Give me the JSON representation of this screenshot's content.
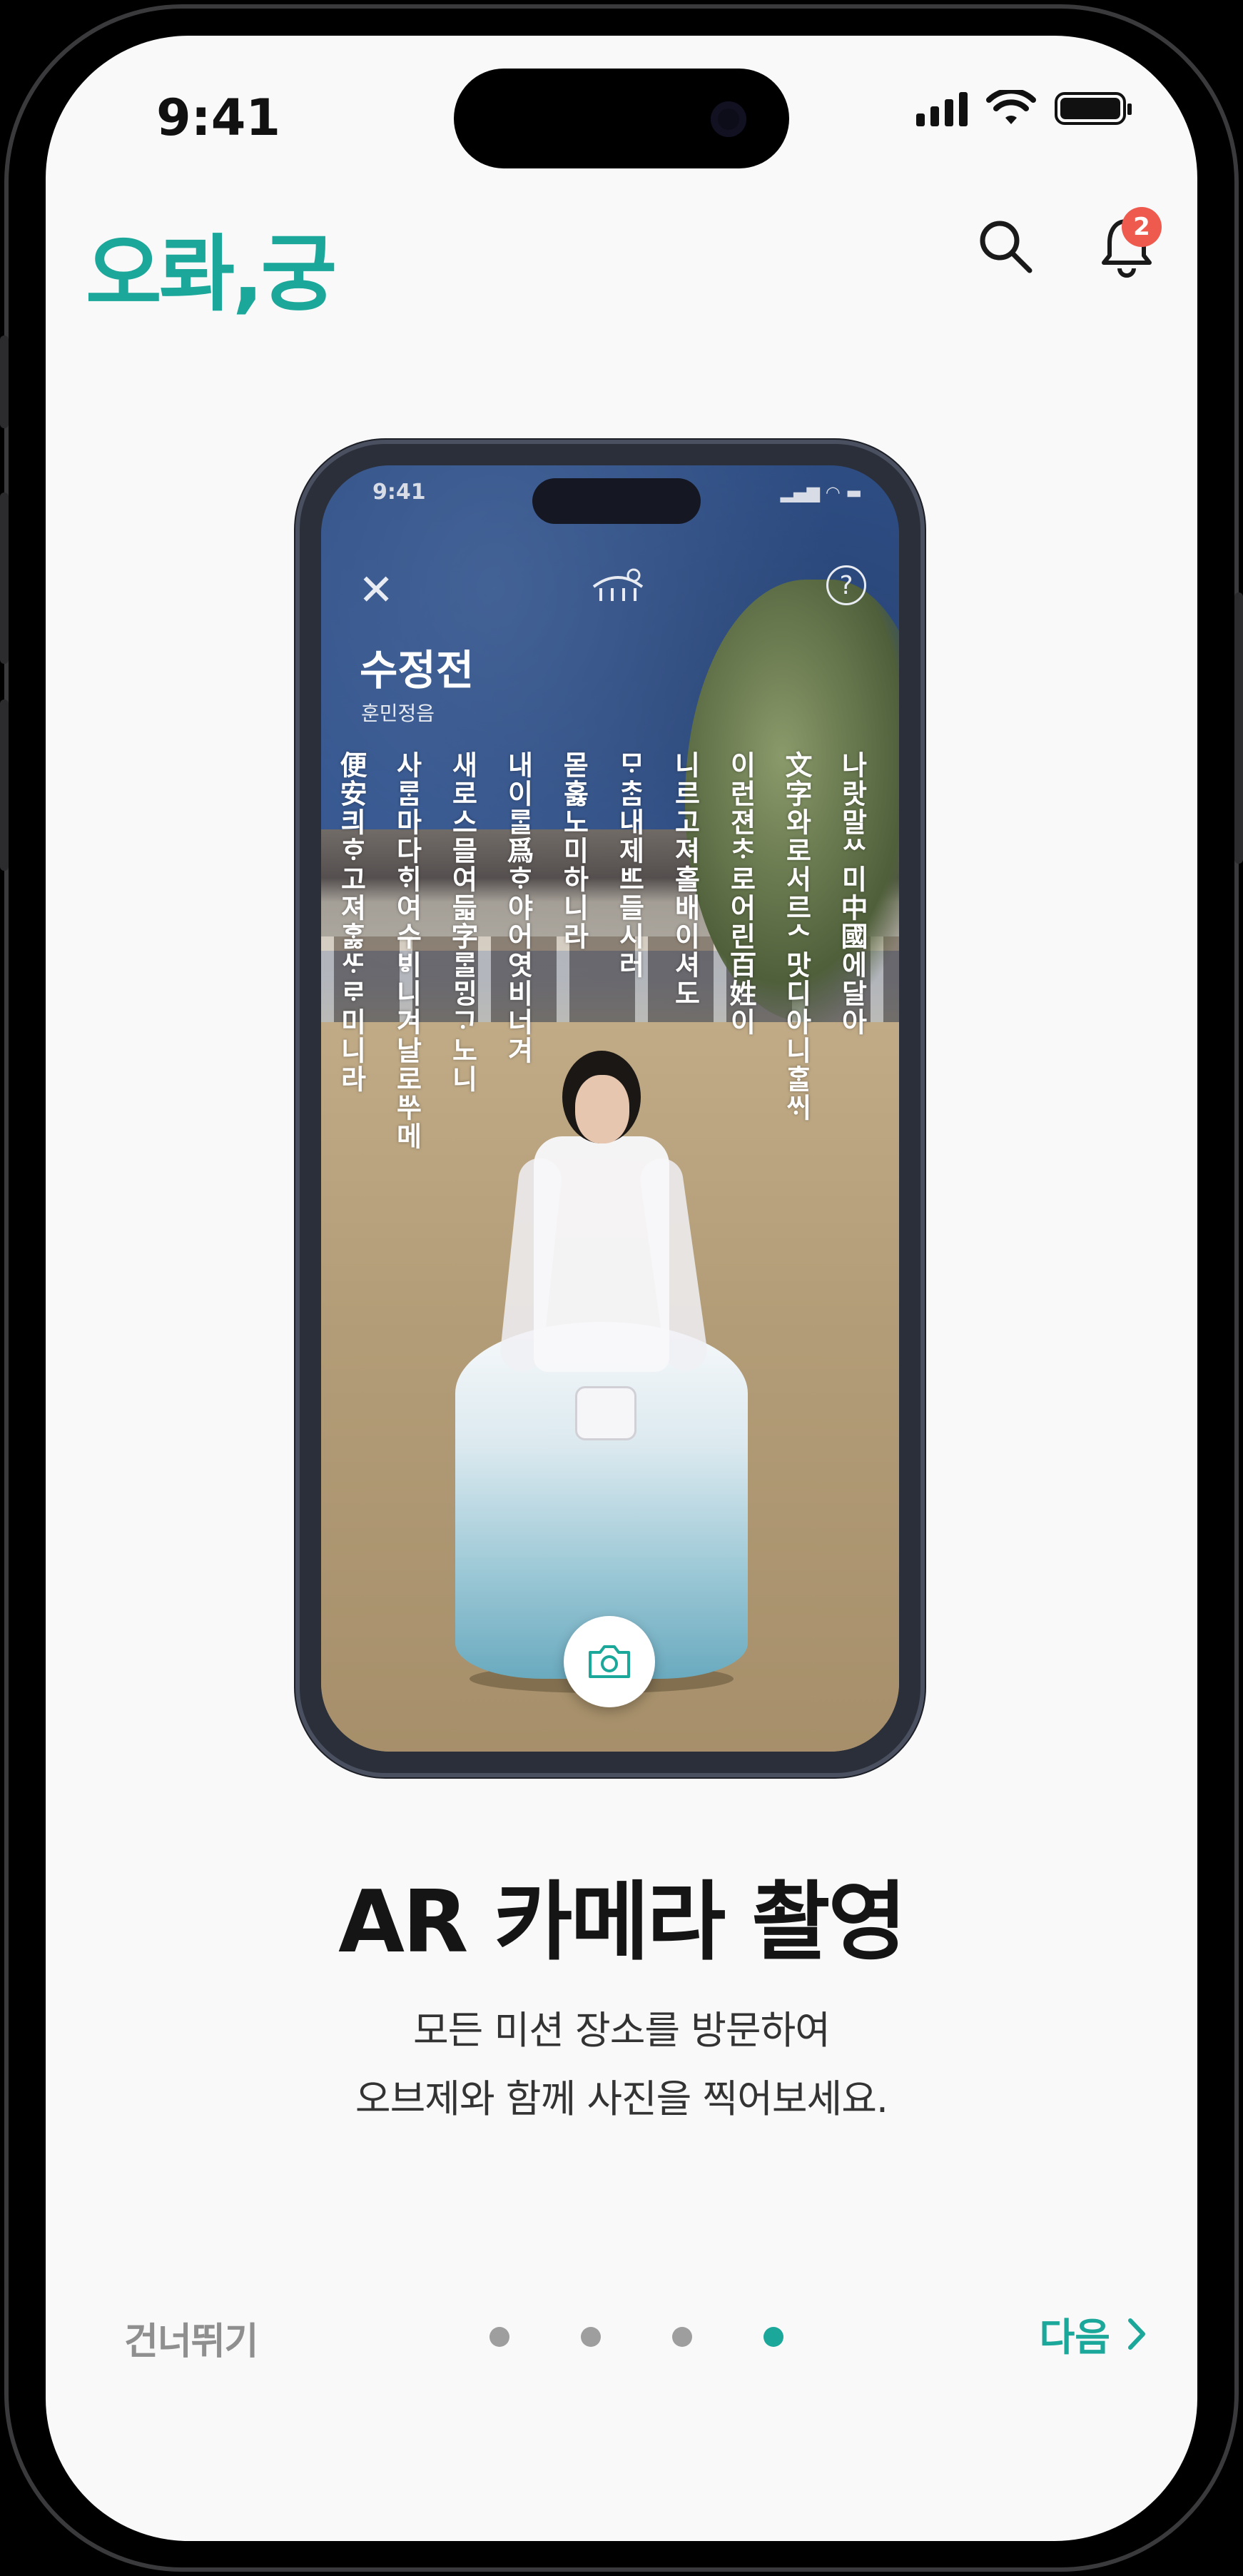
{
  "status_bar": {
    "time": "9:41"
  },
  "header": {
    "logo": "오롸,궁",
    "notification_count": "2"
  },
  "mockup": {
    "status_time": "9:41",
    "title": "수정전",
    "subtitle": "훈민정음",
    "verse_columns": [
      "나랏말ᄊ미中國에달아",
      "文字와로서르ᄉ맛디아니ᄒᆞᆯᄊᆡ",
      "이런젼ᄎᆞ로어린百姓이",
      "니르고져홀배이셔도",
      "ᄆᆞᄎᆞᆷ내제ᄠᅳ들시러",
      "몯홇노미하니라",
      "내이ᄅᆞᆯ爲ᄒᆞ야어엿비너겨",
      "새로스믈여듧字ᄅᆞᆯᄆᆡᆼᄀᆞ노니",
      "사ᄅᆞᆷ마다ᄒᆡ여수ᄫᅵ니겨날로ᄡᅮ메",
      "便安킈ᄒᆞ고져ᄒᆞᇙᄯᆞᄅᆞ미니라"
    ]
  },
  "content": {
    "title": "AR 카메라 촬영",
    "description_line1": "모든 미션 장소를 방문하여",
    "description_line2": "오브제와 함께 사진을 찍어보세요."
  },
  "footer": {
    "skip_label": "건너뛰기",
    "next_label": "다음",
    "pagination": {
      "total": 4,
      "current": 4
    }
  },
  "colors": {
    "accent": "#1ba89a",
    "badge": "#ef5a4f",
    "background": "#f9f9f9"
  }
}
